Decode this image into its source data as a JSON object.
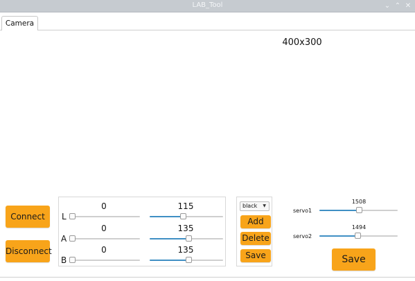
{
  "window": {
    "title": "LAB_Tool"
  },
  "tabs": [
    {
      "label": "Camera"
    }
  ],
  "camera": {
    "resolution_label": "400x300"
  },
  "connection": {
    "connect_label": "Connect",
    "disconnect_label": "Disconnect"
  },
  "lab": {
    "channels": [
      {
        "letter": "L",
        "min": 0,
        "max": 115,
        "min_fraction": 0.0,
        "max_fraction": 0.45
      },
      {
        "letter": "A",
        "min": 0,
        "max": 135,
        "min_fraction": 0.0,
        "max_fraction": 0.53
      },
      {
        "letter": "B",
        "min": 0,
        "max": 135,
        "min_fraction": 0.0,
        "max_fraction": 0.53
      }
    ]
  },
  "color": {
    "selected": "black",
    "add_label": "Add",
    "delete_label": "Delete",
    "save_label": "Save"
  },
  "servos": [
    {
      "label": "servo1",
      "value": 1508,
      "fraction": 0.5
    },
    {
      "label": "servo2",
      "value": 1494,
      "fraction": 0.49
    }
  ],
  "servo_save_label": "Save",
  "colors": {
    "button": "#f8a41a",
    "slider_fill": "#3f8fc4",
    "titlebar": "#c6cbd0"
  }
}
